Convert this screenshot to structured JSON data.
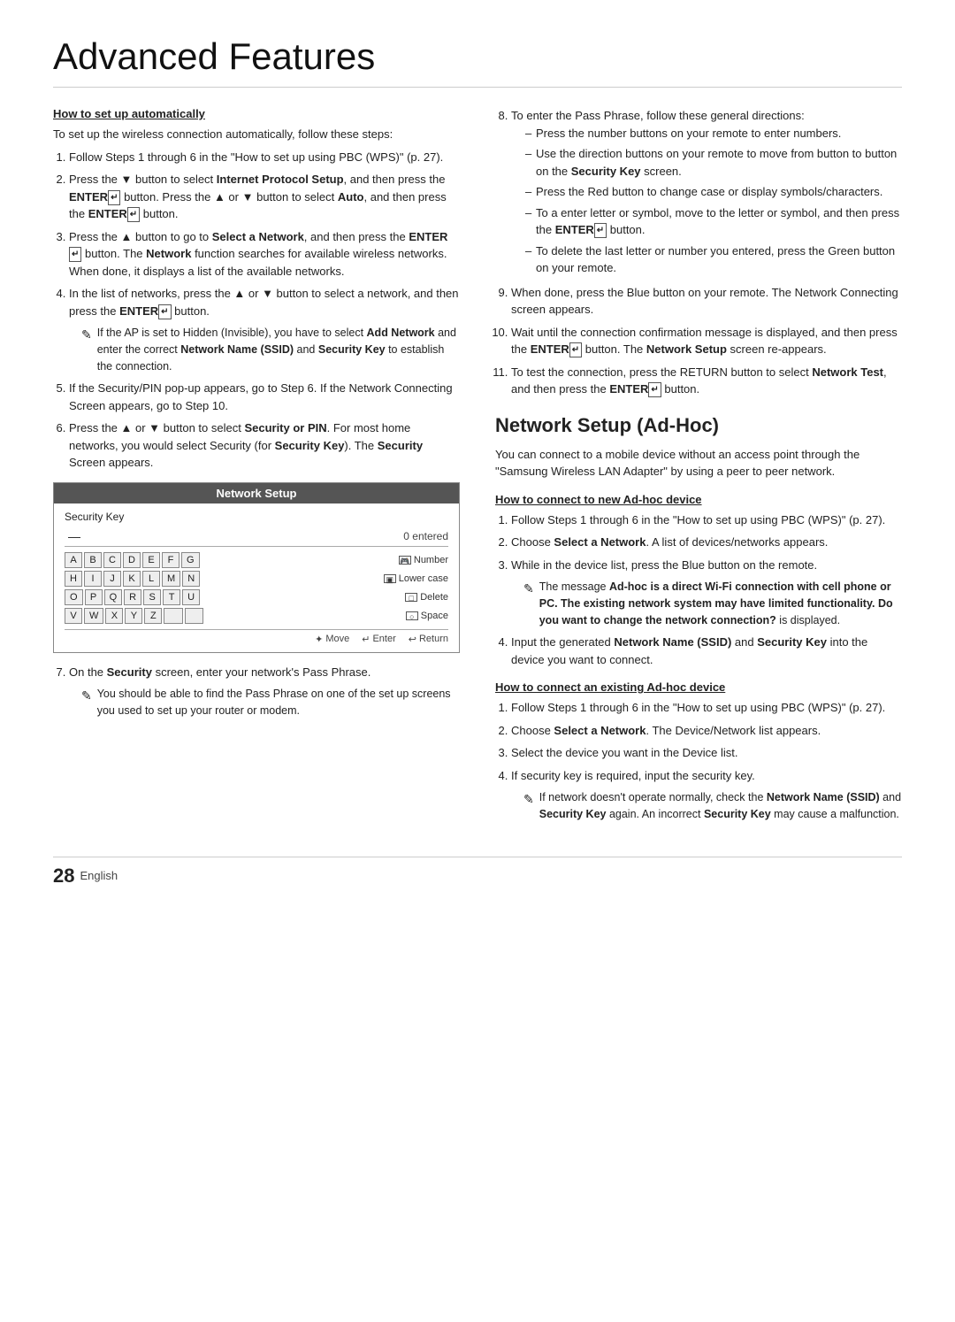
{
  "page": {
    "title": "Advanced Features",
    "footer_number": "28",
    "footer_lang": "English"
  },
  "left_col": {
    "how_to_heading": "How to set up automatically",
    "intro": "To set up the wireless connection automatically, follow these steps:",
    "steps": [
      {
        "num": "1",
        "text": "Follow Steps 1 through 6 in the \"How to set up using PBC (WPS)\" (p. 27)."
      },
      {
        "num": "2",
        "text_parts": [
          {
            "text": "Press the ▼ button to select ",
            "bold": false
          },
          {
            "text": "Internet Protocol Setup",
            "bold": true
          },
          {
            "text": ", and then press the ",
            "bold": false
          },
          {
            "text": "ENTER",
            "bold": true
          },
          {
            "text": " button. Press the ▲ or ▼ button to select ",
            "bold": false
          },
          {
            "text": "Auto",
            "bold": true
          },
          {
            "text": ", and then press the ",
            "bold": false
          },
          {
            "text": "ENTER",
            "bold": true
          },
          {
            "text": " button.",
            "bold": false
          }
        ]
      },
      {
        "num": "3",
        "text_parts": [
          {
            "text": "Press the ▲ button to go to ",
            "bold": false
          },
          {
            "text": "Select a Network",
            "bold": true
          },
          {
            "text": ", and then press the ",
            "bold": false
          },
          {
            "text": "ENTER",
            "bold": true
          },
          {
            "text": " button. The ",
            "bold": false
          },
          {
            "text": "Network",
            "bold": true
          },
          {
            "text": " function searches for available wireless networks. When done, it displays a list of the available networks.",
            "bold": false
          }
        ]
      },
      {
        "num": "4",
        "text_parts": [
          {
            "text": "In the list of networks, press the ▲ or ▼ button to select a network, and then press the ",
            "bold": false
          },
          {
            "text": "ENTER",
            "bold": true
          },
          {
            "text": " button.",
            "bold": false
          }
        ],
        "note": {
          "text_parts": [
            {
              "text": "If the AP is set to Hidden (Invisible), you have to select ",
              "bold": false
            },
            {
              "text": "Add Network",
              "bold": true
            },
            {
              "text": " and enter the correct ",
              "bold": false
            },
            {
              "text": "Network Name (SSID)",
              "bold": true
            },
            {
              "text": " and ",
              "bold": false
            },
            {
              "text": "Security Key",
              "bold": true
            },
            {
              "text": " to establish the connection.",
              "bold": false
            }
          ]
        }
      },
      {
        "num": "5",
        "text": "If the Security/PIN pop-up appears, go to Step 6. If the Network Connecting Screen appears, go to Step 10."
      },
      {
        "num": "6",
        "text_parts": [
          {
            "text": "Press the ▲ or ▼ button to select ",
            "bold": false
          },
          {
            "text": "Security or PIN",
            "bold": true
          },
          {
            "text": ". For most home networks, you would select Security (for ",
            "bold": false
          },
          {
            "text": "Security Key",
            "bold": true
          },
          {
            "text": "). The ",
            "bold": false
          },
          {
            "text": "Security",
            "bold": true
          },
          {
            "text": " Screen appears.",
            "bold": false
          }
        ]
      }
    ],
    "network_setup_box": {
      "header": "Network Setup",
      "security_key_label": "Security Key",
      "dash": "—",
      "entered": "0 entered",
      "rows": [
        {
          "keys": [
            "A",
            "B",
            "C",
            "D",
            "E",
            "F",
            "G"
          ],
          "action_icon": "🎮",
          "action_label": "Number"
        },
        {
          "keys": [
            "H",
            "I",
            "J",
            "K",
            "L",
            "M",
            "N"
          ],
          "action_icon": "▣",
          "action_label": "Lower case"
        },
        {
          "keys": [
            "O",
            "P",
            "Q",
            "R",
            "S",
            "T",
            "U"
          ],
          "action_icon": "□",
          "action_label": "Delete"
        },
        {
          "keys": [
            "V",
            "W",
            "X",
            "Y",
            "Z",
            "",
            ""
          ],
          "action_icon": "○",
          "action_label": "Space"
        }
      ],
      "nav_items": [
        {
          "icon": "✦",
          "label": "Move"
        },
        {
          "icon": "↵",
          "label": "Enter"
        },
        {
          "icon": "↩",
          "label": "Return"
        }
      ]
    },
    "step7": {
      "num": "7",
      "text_parts": [
        {
          "text": "On the ",
          "bold": false
        },
        {
          "text": "Security",
          "bold": true
        },
        {
          "text": " screen, enter your network's Pass Phrase.",
          "bold": false
        }
      ],
      "note": "You should be able to find the Pass Phrase on one of the set up screens you used to set up your router or modem."
    }
  },
  "right_col": {
    "step8": {
      "num": "8",
      "text": "To enter the Pass Phrase, follow these general directions:",
      "bullets": [
        "Press the number buttons on your remote to enter numbers.",
        "Use the direction buttons on your remote to move from button to button on the Security Key screen.",
        "Press the Red button to change case or display symbols/characters.",
        "To a enter letter or symbol, move to the letter or symbol, and then press the ENTER button.",
        "To delete the last letter or number you entered, press the Green button on your remote."
      ]
    },
    "step9": {
      "num": "9",
      "text_parts": [
        {
          "text": "When done, press the Blue button on your remote. The Network Connecting screen appears.",
          "bold": false
        }
      ]
    },
    "step10": {
      "num": "10",
      "text_parts": [
        {
          "text": "Wait until the connection confirmation message is displayed, and then press the ",
          "bold": false
        },
        {
          "text": "ENTER",
          "bold": true
        },
        {
          "text": " button. The ",
          "bold": false
        },
        {
          "text": "Network Setup",
          "bold": true
        },
        {
          "text": " screen re-appears.",
          "bold": false
        }
      ]
    },
    "step11": {
      "num": "11",
      "text_parts": [
        {
          "text": "To test the connection, press the RETURN button to select ",
          "bold": false
        },
        {
          "text": "Network Test",
          "bold": true
        },
        {
          "text": ", and then press the ",
          "bold": false
        },
        {
          "text": "ENTER",
          "bold": true
        },
        {
          "text": " button.",
          "bold": false
        }
      ]
    },
    "adhoc_title": "Network Setup (Ad-Hoc)",
    "adhoc_intro": "You can connect to a mobile device without an access point through the \"Samsung Wireless LAN Adapter\" by using a peer to peer network.",
    "connect_new_heading": "How to connect to new Ad-hoc device",
    "connect_new_steps": [
      {
        "num": "1",
        "text": "Follow Steps 1 through 6 in the \"How to set up using PBC (WPS)\" (p. 27)."
      },
      {
        "num": "2",
        "text_parts": [
          {
            "text": "Choose ",
            "bold": false
          },
          {
            "text": "Select a Network",
            "bold": true
          },
          {
            "text": ". A list of devices/networks appears.",
            "bold": false
          }
        ]
      },
      {
        "num": "3",
        "text": "While in the device list, press the Blue button on the remote.",
        "note_parts": [
          {
            "text": "The message ",
            "bold": false
          },
          {
            "text": "Ad-hoc is a direct Wi-Fi connection with cell phone or PC. The existing network system may have limited functionality. Do you want to change the network connection?",
            "bold": true
          },
          {
            "text": " is displayed.",
            "bold": false
          }
        ]
      },
      {
        "num": "4",
        "text_parts": [
          {
            "text": "Input the generated ",
            "bold": false
          },
          {
            "text": "Network Name (SSID)",
            "bold": true
          },
          {
            "text": " and ",
            "bold": false
          },
          {
            "text": "Security Key",
            "bold": true
          },
          {
            "text": " into the device you want to connect.",
            "bold": false
          }
        ]
      }
    ],
    "connect_existing_heading": "How to connect an existing Ad-hoc device",
    "connect_existing_steps": [
      {
        "num": "1",
        "text": "Follow Steps 1 through 6 in the \"How to set up using PBC (WPS)\" (p. 27)."
      },
      {
        "num": "2",
        "text_parts": [
          {
            "text": "Choose ",
            "bold": false
          },
          {
            "text": "Select a Network",
            "bold": true
          },
          {
            "text": ". The Device/Network list appears.",
            "bold": false
          }
        ]
      },
      {
        "num": "3",
        "text": "Select the device you want in the Device list."
      },
      {
        "num": "4",
        "text": "If security key is required, input the security key.",
        "note_parts": [
          {
            "text": "If network doesn't operate normally, check the ",
            "bold": false
          },
          {
            "text": "Network Name (SSID)",
            "bold": true
          },
          {
            "text": " and ",
            "bold": false
          },
          {
            "text": "Security Key",
            "bold": true
          },
          {
            "text": " again. An incorrect ",
            "bold": false
          },
          {
            "text": "Security Key",
            "bold": true
          },
          {
            "text": " may cause a malfunction.",
            "bold": false
          }
        ]
      }
    ]
  }
}
